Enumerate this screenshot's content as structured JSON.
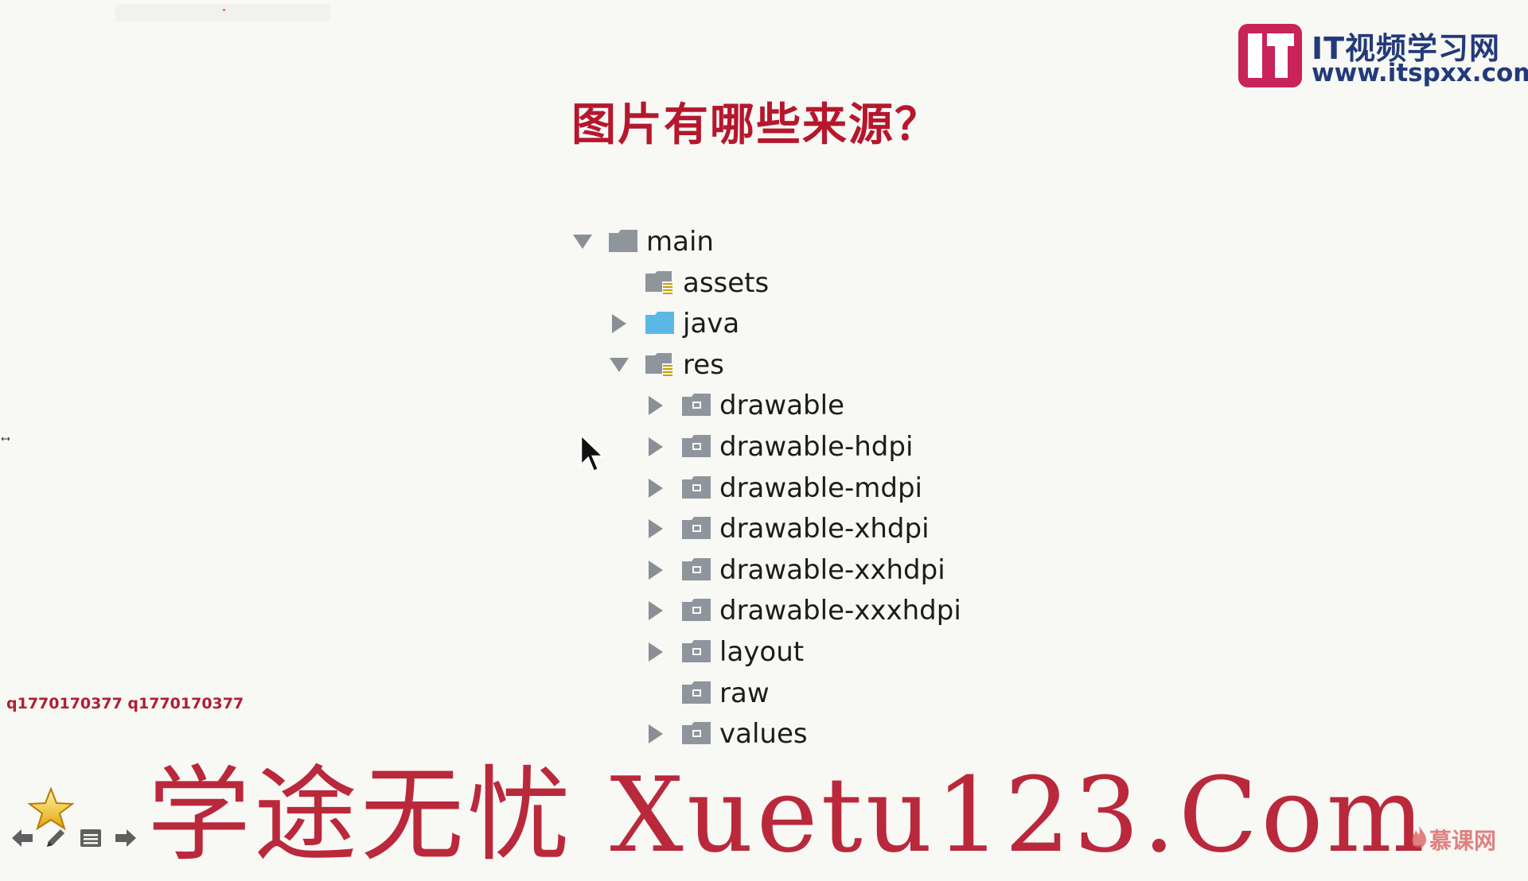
{
  "slide": {
    "title": "图片有哪些来源？"
  },
  "branding": {
    "logo_name": "IT视频学习网",
    "logo_url": "www.itspxx.com",
    "watermark_text": "学途无忧 Xuetu123.Com",
    "qq_text": "q1770170377 q1770170377",
    "corner_brand": "慕课网"
  },
  "tree": [
    {
      "label": "main",
      "level": 0,
      "arrow": "expanded",
      "icon": "folder-gray-icon"
    },
    {
      "label": "assets",
      "level": 1,
      "arrow": "none",
      "icon": "resource-folder-icon"
    },
    {
      "label": "java",
      "level": 1,
      "arrow": "collapsed",
      "icon": "source-folder-blue-icon"
    },
    {
      "label": "res",
      "level": 1,
      "arrow": "expanded",
      "icon": "resource-folder-icon"
    },
    {
      "label": "drawable",
      "level": 2,
      "arrow": "collapsed",
      "icon": "package-folder-icon"
    },
    {
      "label": "drawable-hdpi",
      "level": 2,
      "arrow": "collapsed",
      "icon": "package-folder-icon"
    },
    {
      "label": "drawable-mdpi",
      "level": 2,
      "arrow": "collapsed",
      "icon": "package-folder-icon"
    },
    {
      "label": "drawable-xhdpi",
      "level": 2,
      "arrow": "collapsed",
      "icon": "package-folder-icon"
    },
    {
      "label": "drawable-xxhdpi",
      "level": 2,
      "arrow": "collapsed",
      "icon": "package-folder-icon"
    },
    {
      "label": "drawable-xxxhdpi",
      "level": 2,
      "arrow": "collapsed",
      "icon": "package-folder-icon"
    },
    {
      "label": "layout",
      "level": 2,
      "arrow": "collapsed",
      "icon": "package-folder-icon"
    },
    {
      "label": "raw",
      "level": 2,
      "arrow": "none",
      "icon": "package-folder-icon"
    },
    {
      "label": "values",
      "level": 2,
      "arrow": "collapsed",
      "icon": "package-folder-icon"
    }
  ],
  "nav": {
    "items": [
      "star-icon",
      "back-arrow-icon",
      "pen-icon",
      "menu-icon",
      "forward-arrow-icon"
    ]
  },
  "colors": {
    "background": "#f8f8f4",
    "title": "#b5172d",
    "logo": "#c8235a",
    "logo_text": "#233a7a",
    "watermark": "#b5172d",
    "folder_gray": "#8e959c",
    "folder_blue": "#5bb8e6"
  }
}
